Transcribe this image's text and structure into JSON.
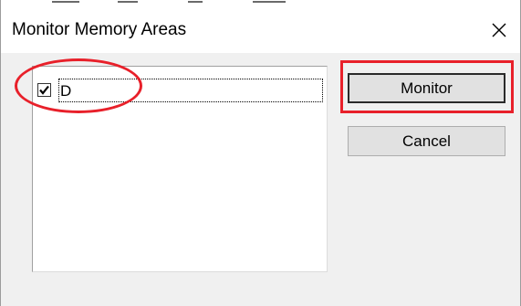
{
  "window": {
    "title": "Monitor Memory Areas",
    "close_icon": "close-icon"
  },
  "memory_list": {
    "items": [
      {
        "label": "D",
        "checked": true
      }
    ]
  },
  "buttons": {
    "monitor_label": "Monitor",
    "cancel_label": "Cancel"
  },
  "annotations": {
    "highlight_color": "#e8202a"
  }
}
